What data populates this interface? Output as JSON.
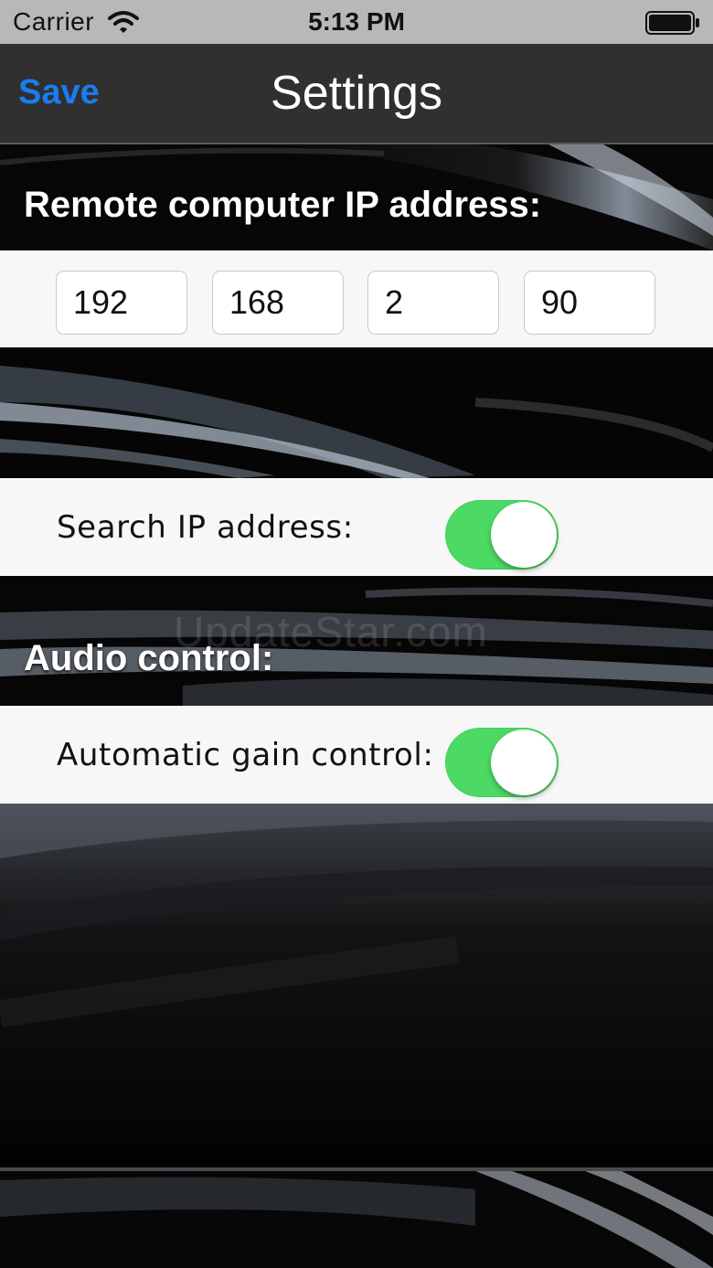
{
  "status_bar": {
    "carrier": "Carrier",
    "time": "5:13 PM",
    "wifi_icon": "wifi-icon",
    "battery_icon": "battery-icon"
  },
  "nav_bar": {
    "save_label": "Save",
    "title": "Settings"
  },
  "remote_ip": {
    "heading": "Remote computer IP address:",
    "octets": [
      "192",
      "168",
      "2",
      "90"
    ]
  },
  "search_ip": {
    "label": "Search IP address:",
    "enabled": true
  },
  "audio": {
    "heading": "Audio control:",
    "agc_label": "Automatic gain control:",
    "agc_enabled": true
  },
  "watermark": "UpdateStar.com",
  "colors": {
    "accent_blue": "#1a7cf0",
    "toggle_on": "#4cd964",
    "nav_background": "#303030",
    "status_background": "#b8b8b8"
  }
}
